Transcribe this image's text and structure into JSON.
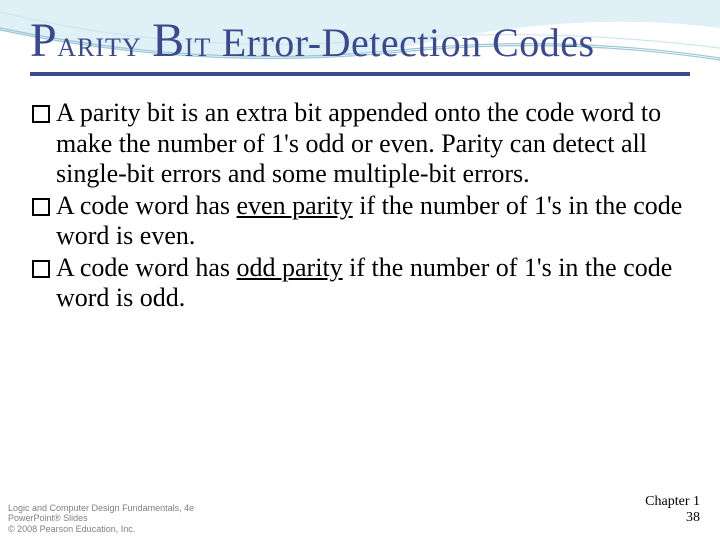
{
  "title": {
    "word1_cap": "P",
    "word1_rest": "ARITY",
    "word2_cap": "B",
    "word2_rest": "IT",
    "remainder": "Error-Detection Codes"
  },
  "bullets": [
    {
      "pre": "A parity bit is an extra bit appended onto the code word to make the number of 1's odd or even. Parity can detect all single-bit errors and some multiple-bit errors.",
      "uline": "",
      "post": ""
    },
    {
      "pre": "A code word has ",
      "uline": "even parity",
      "post": " if the number of 1's in the code word is even."
    },
    {
      "pre": "A code word has ",
      "uline": "odd parity",
      "post": " if the number of 1's in the code word is odd."
    }
  ],
  "footer": {
    "line1": "Logic and Computer Design Fundamentals, 4e",
    "line2": "PowerPoint® Slides",
    "line3": "© 2008 Pearson Education, Inc."
  },
  "footer_right": {
    "chapter": "Chapter 1",
    "page": "38"
  }
}
